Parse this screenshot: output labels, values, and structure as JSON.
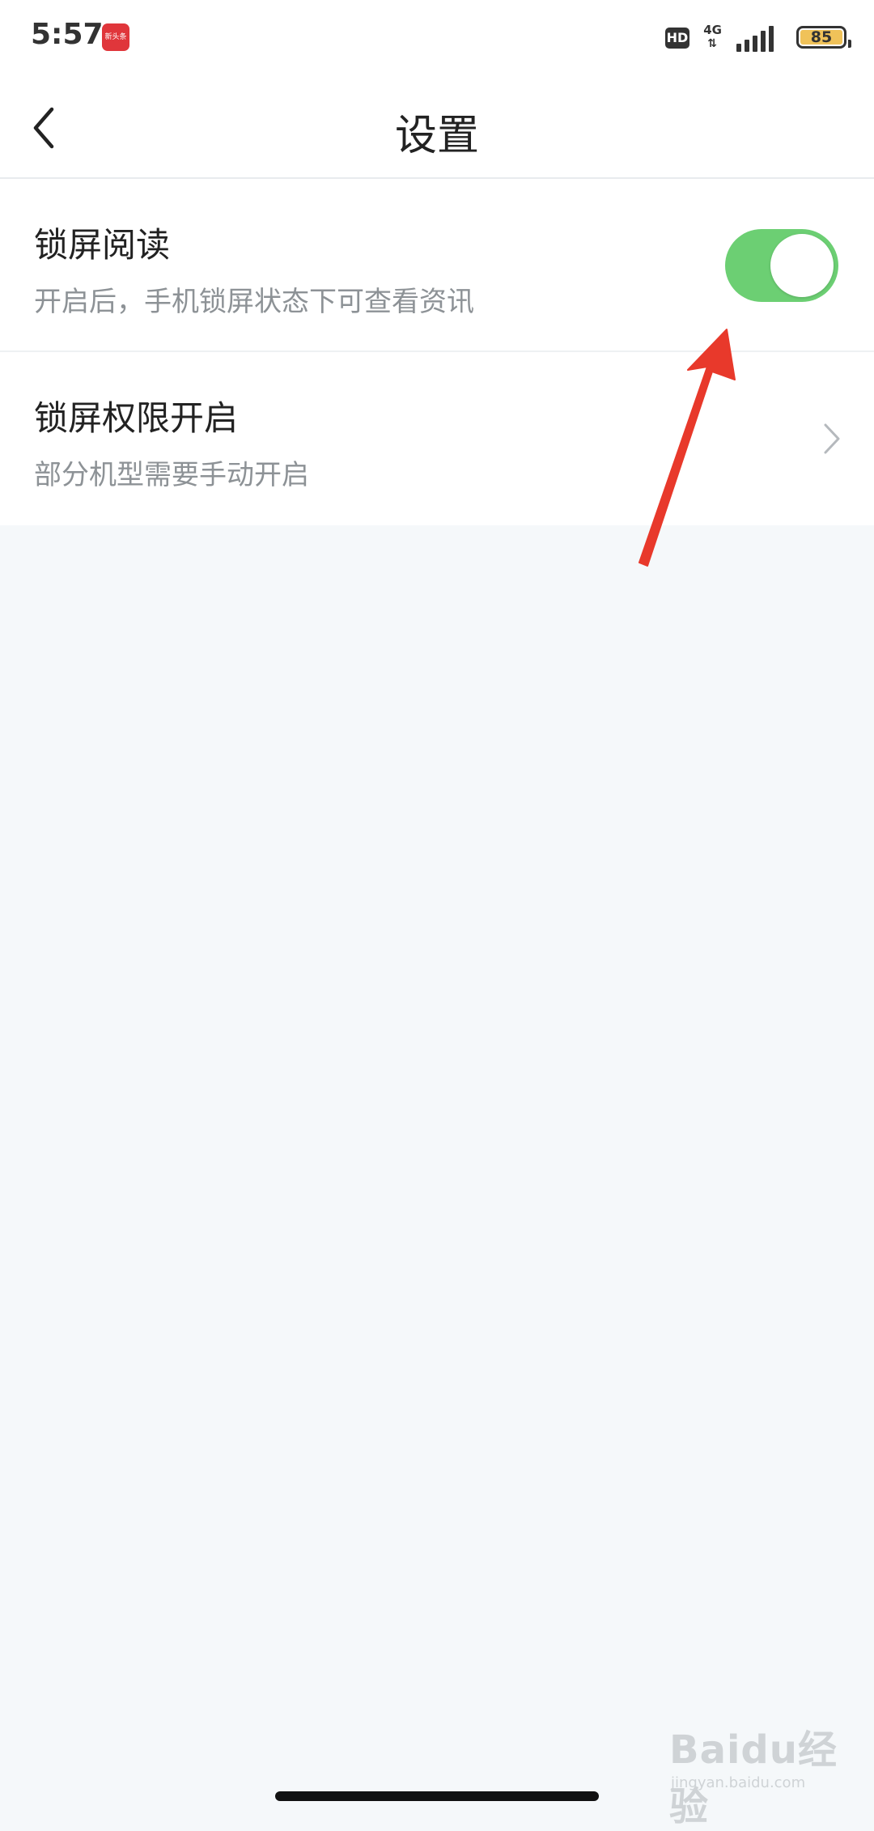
{
  "status_bar": {
    "time": "5:57",
    "app_badge_text": "新头条",
    "hd_label": "HD",
    "network_label": "4G",
    "network_arrows": "⇅",
    "battery_level": "85",
    "signal_icon": "signal-bars-icon",
    "battery_icon": "battery-icon"
  },
  "nav": {
    "title": "设置",
    "back_icon": "chevron-left-icon"
  },
  "settings": {
    "items": [
      {
        "title": "锁屏阅读",
        "description": "开启后，手机锁屏状态下可查看资讯",
        "control": "toggle",
        "toggle_on": true
      },
      {
        "title": "锁屏权限开启",
        "description": "部分机型需要手动开启",
        "control": "chevron",
        "chevron_icon": "chevron-right-icon"
      }
    ]
  },
  "annotation": {
    "arrow_icon": "red-arrow-icon",
    "arrow_color": "#e8392b"
  },
  "watermark": {
    "brand": "Baidu经验",
    "url": "jingyan.baidu.com"
  },
  "colors": {
    "toggle_on": "#6ccf73",
    "background": "#f5f8fa",
    "app_badge": "#e0363b"
  }
}
